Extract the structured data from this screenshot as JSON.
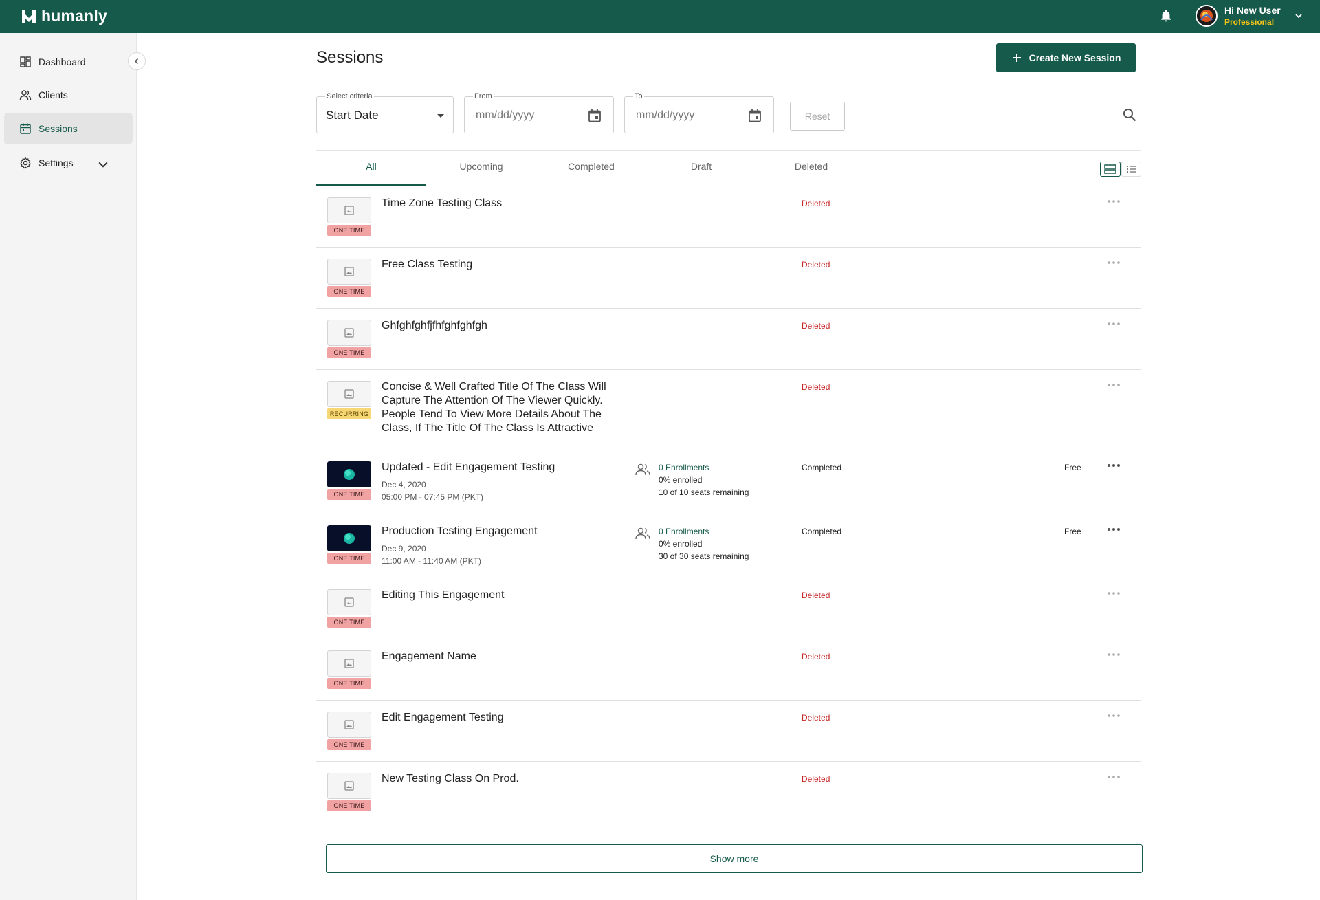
{
  "header": {
    "brand": "humanly",
    "greeting": "Hi New User",
    "plan": "Professional"
  },
  "sidebar": {
    "items": [
      {
        "label": "Dashboard",
        "icon": "dashboard-icon"
      },
      {
        "label": "Clients",
        "icon": "clients-icon"
      },
      {
        "label": "Sessions",
        "icon": "calendar-icon"
      },
      {
        "label": "Settings",
        "icon": "gear-icon"
      }
    ],
    "active": "Sessions"
  },
  "main": {
    "title": "Sessions",
    "create_label": "Create New Session",
    "filters": {
      "criteria_label": "Select criteria",
      "criteria_value": "Start Date",
      "from_label": "From",
      "from_placeholder": "mm/dd/yyyy",
      "to_label": "To",
      "to_placeholder": "mm/dd/yyyy",
      "reset_label": "Reset"
    },
    "tabs": [
      "All",
      "Upcoming",
      "Completed",
      "Draft",
      "Deleted"
    ],
    "active_tab": "All",
    "sessions": [
      {
        "title": "Time Zone Testing Class",
        "type": "ONE TIME",
        "status": "Deleted",
        "has_image": false
      },
      {
        "title": "Free Class Testing",
        "type": "ONE TIME",
        "status": "Deleted",
        "has_image": false
      },
      {
        "title": "Ghfghfghfjfhfghfghfgh",
        "type": "ONE TIME",
        "status": "Deleted",
        "has_image": false
      },
      {
        "title": "Concise & Well Crafted Title Of The Class Will Capture The Attention Of The Viewer Quickly. People Tend To View More Details About The Class, If The Title Of The Class Is Attractive",
        "type": "RECURRING",
        "status": "Deleted",
        "has_image": false
      },
      {
        "title": "Updated - Edit Engagement Testing",
        "type": "ONE TIME",
        "status": "Completed",
        "has_image": true,
        "date": "Dec 4, 2020",
        "time": "05:00 PM - 07:45 PM (PKT)",
        "enrollments": "0 Enrollments",
        "enrolled": "0% enrolled",
        "seats": "10 of 10 seats remaining",
        "price": "Free"
      },
      {
        "title": "Production Testing Engagement",
        "type": "ONE TIME",
        "status": "Completed",
        "has_image": true,
        "date": "Dec 9, 2020",
        "time": "11:00 AM - 11:40 AM (PKT)",
        "enrollments": "0 Enrollments",
        "enrolled": "0% enrolled",
        "seats": "30 of 30 seats remaining",
        "price": "Free"
      },
      {
        "title": "Editing This Engagement",
        "type": "ONE TIME",
        "status": "Deleted",
        "has_image": false
      },
      {
        "title": "Engagement Name",
        "type": "ONE TIME",
        "status": "Deleted",
        "has_image": false
      },
      {
        "title": "Edit Engagement Testing",
        "type": "ONE TIME",
        "status": "Deleted",
        "has_image": false
      },
      {
        "title": "New Testing Class On Prod.",
        "type": "ONE TIME",
        "status": "Deleted",
        "has_image": false
      }
    ],
    "show_more_label": "Show more"
  },
  "colors": {
    "brand": "#155a4a",
    "deleted": "#c62828",
    "one_time_badge": "#f1a2a2",
    "recurring_badge": "#f7d774",
    "plan_text": "#f5c518"
  }
}
